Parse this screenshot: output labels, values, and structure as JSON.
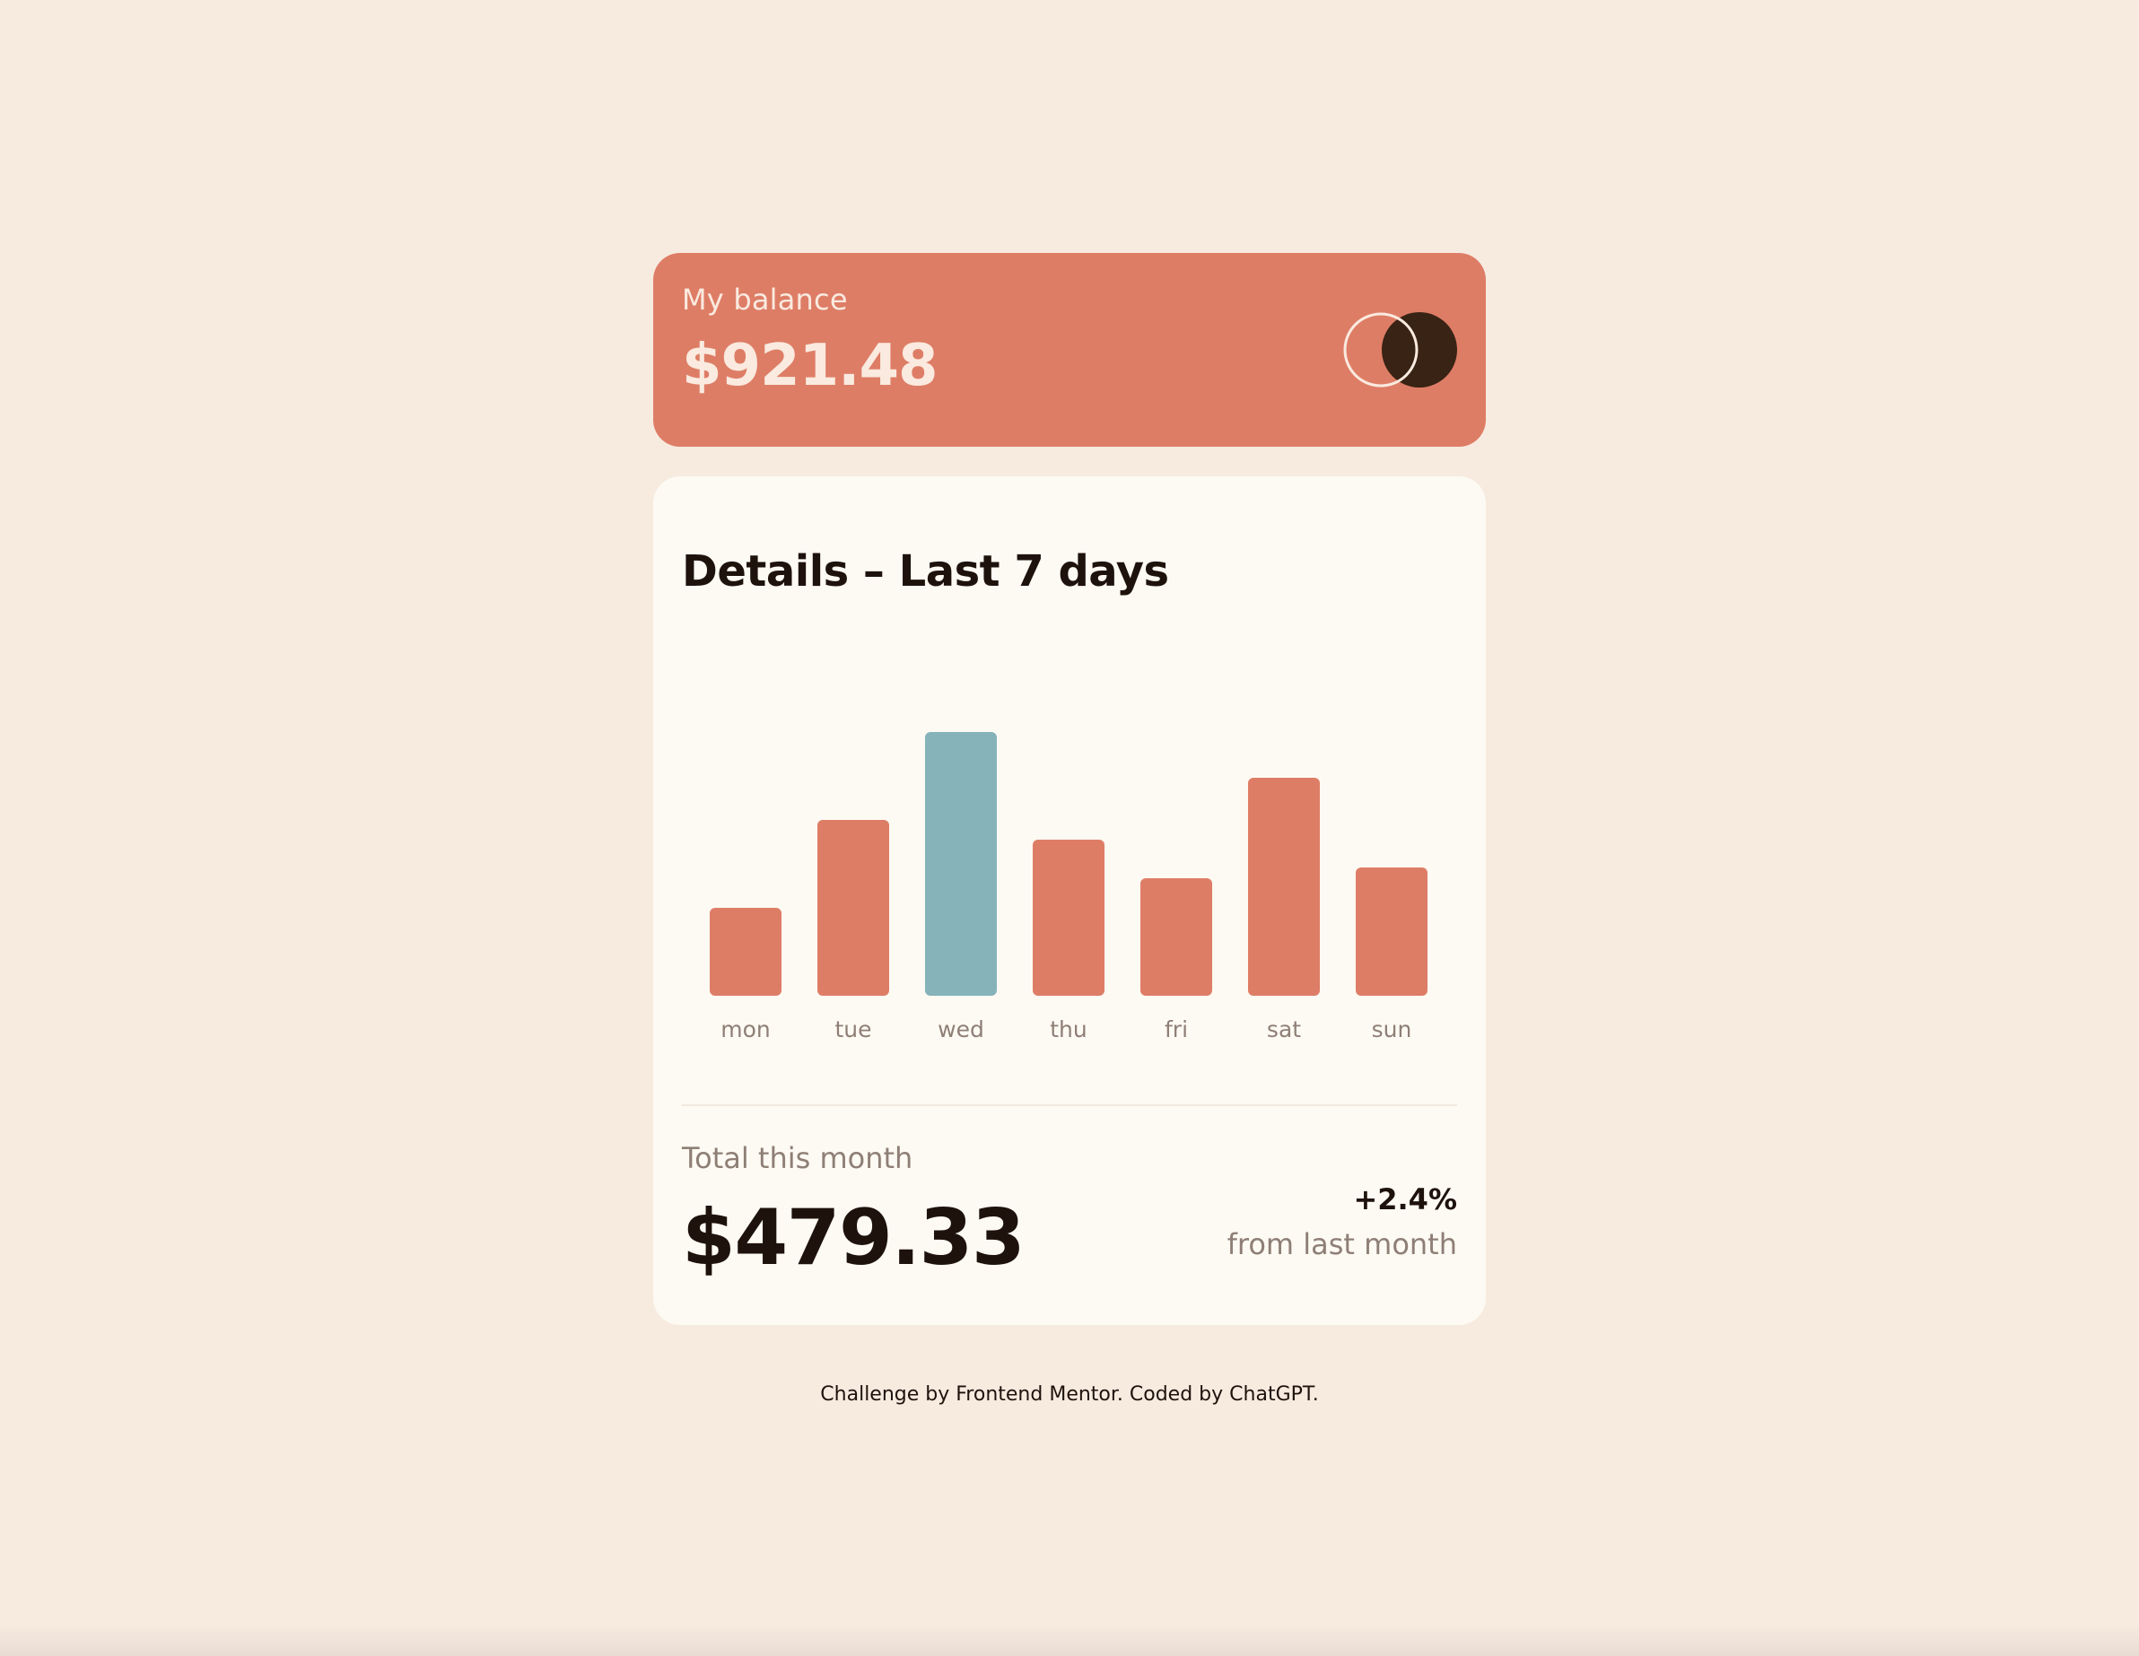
{
  "balance": {
    "label": "My balance",
    "amount": "$921.48"
  },
  "details": {
    "title": "Details – Last 7 days"
  },
  "chart_data": {
    "type": "bar",
    "categories": [
      "mon",
      "tue",
      "wed",
      "thu",
      "fri",
      "sat",
      "sun"
    ],
    "values": [
      17.45,
      34.91,
      52.36,
      31.07,
      23.39,
      43.28,
      25.48
    ],
    "highlight_index": 2,
    "title": "",
    "xlabel": "",
    "ylabel": "",
    "ylim": [
      0,
      52.36
    ],
    "grid": false,
    "colors": {
      "bar": "#DE7D66",
      "highlight": "#86B3BA"
    }
  },
  "summary": {
    "total_label": "Total this month",
    "total_amount": "$479.33",
    "change_value": "+2.4%",
    "change_label": "from last month"
  },
  "footer": {
    "attribution": "Challenge by Frontend Mentor. Coded by ChatGPT."
  },
  "colors": {
    "page_background": "#F7EBE0",
    "accent": "#DE7D66",
    "highlight": "#86B3BA",
    "dark": "#1E120C",
    "muted": "#8E7F76",
    "card": "#FDFAF3"
  },
  "icons": {
    "logo": "overlapping-circles-logo-icon"
  }
}
